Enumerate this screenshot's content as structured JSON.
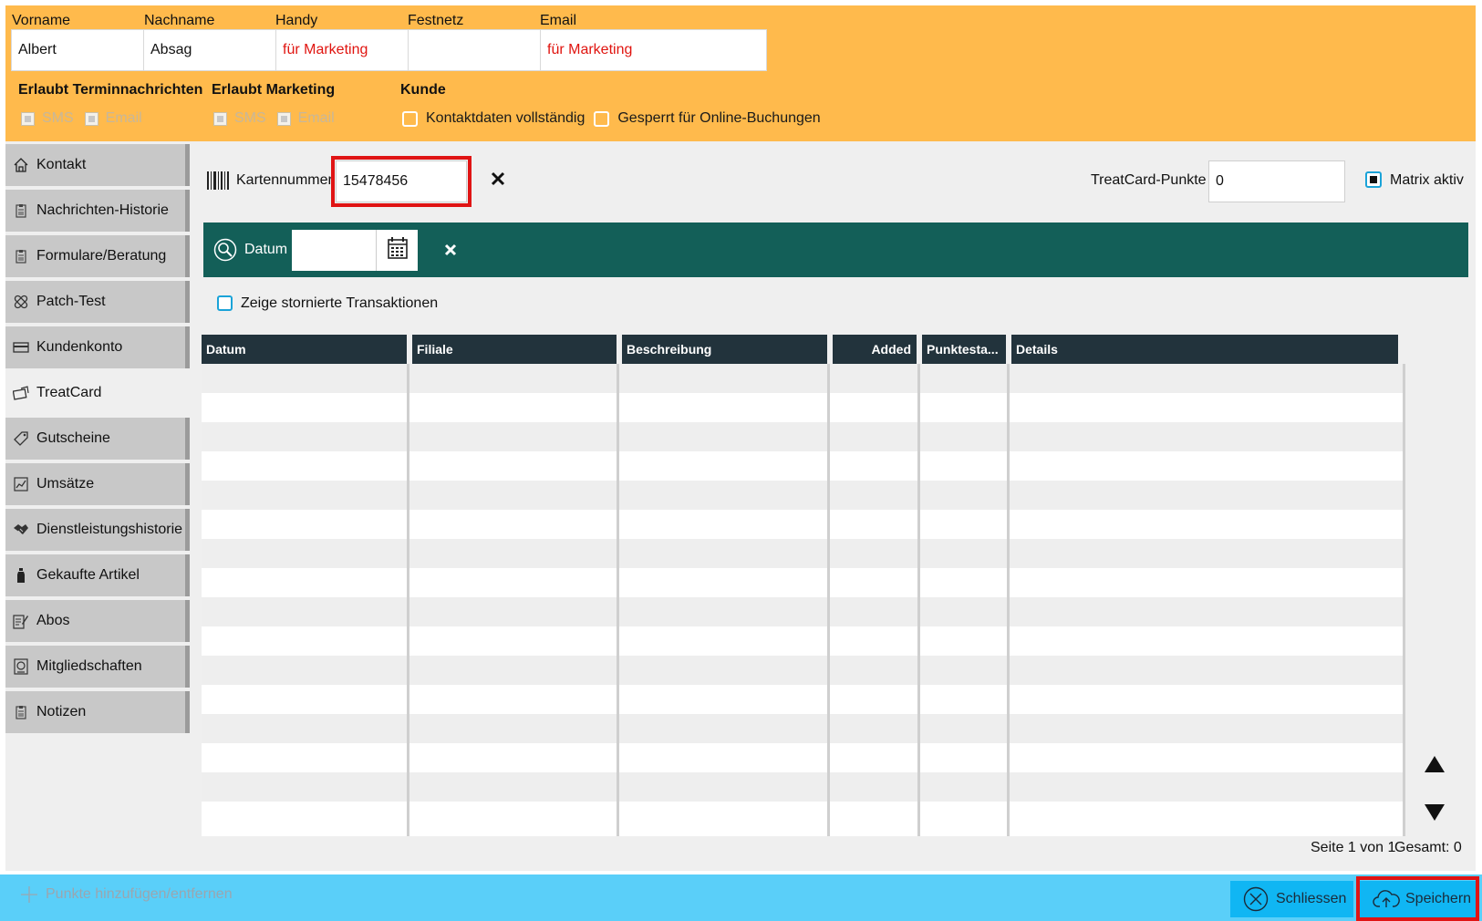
{
  "header": {
    "labels": [
      "Vorname",
      "Nachname",
      "Handy",
      "Festnetz",
      "Email"
    ],
    "values": [
      "Albert",
      "Absag",
      "für Marketing",
      "",
      "für Marketing"
    ],
    "section_termin": "Erlaubt Terminnachrichten",
    "section_marketing": "Erlaubt Marketing",
    "section_kunde": "Kunde",
    "sms": "SMS",
    "email": "Email",
    "kontaktdaten": "Kontaktdaten vollständig",
    "gesperrt": "Gesperrt für Online-Buchungen"
  },
  "sidebar": {
    "items": [
      {
        "label": "Kontakt",
        "icon": "home-icon"
      },
      {
        "label": "Nachrichten-Historie",
        "icon": "clipboard-icon"
      },
      {
        "label": "Formulare/Beratung",
        "icon": "clipboard-icon"
      },
      {
        "label": "Patch-Test",
        "icon": "bandage-icon"
      },
      {
        "label": "Kundenkonto",
        "icon": "card-icon"
      },
      {
        "label": "TreatCard",
        "icon": "treatcard-icon"
      },
      {
        "label": "Gutscheine",
        "icon": "tag-icon"
      },
      {
        "label": "Umsätze",
        "icon": "chart-icon"
      },
      {
        "label": "Dienstleistungshistorie",
        "icon": "handshake-icon"
      },
      {
        "label": "Gekaufte Artikel",
        "icon": "bottle-icon"
      },
      {
        "label": "Abos",
        "icon": "edit-icon"
      },
      {
        "label": "Mitgliedschaften",
        "icon": "membership-icon"
      },
      {
        "label": "Notizen",
        "icon": "clipboard-icon"
      }
    ],
    "active": "TreatCard"
  },
  "card": {
    "label": "Kartennummer",
    "value": "15478456",
    "points_label": "TreatCard-Punkte",
    "points_value": "0",
    "matrix_label": "Matrix aktiv"
  },
  "filter": {
    "datum_label": "Datum",
    "datum_value": "",
    "storniert_label": "Zeige stornierte Transaktionen"
  },
  "table": {
    "columns": [
      "Datum",
      "Filiale",
      "Beschreibung",
      "Added",
      "Punktesta...",
      "Details"
    ],
    "rows": []
  },
  "pagination": {
    "page_text": "Seite 1 von 1",
    "total_text": "Gesamt: 0"
  },
  "footer": {
    "add_points": "Punkte hinzufügen/entfernen",
    "close": "Schliessen",
    "save": "Speichern"
  },
  "colors": {
    "header_bg": "#FFBA4C",
    "filter_bg": "#135F58",
    "table_header_bg": "#22333C",
    "footer_bg": "#5ACFF9",
    "button_bg": "#10B6F3",
    "highlight": "#E01414",
    "marketing_red": "#E0140F"
  }
}
